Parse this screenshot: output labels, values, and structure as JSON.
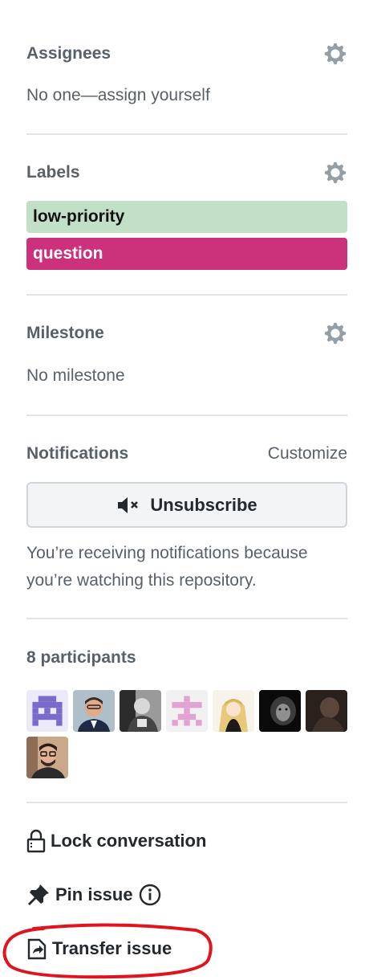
{
  "assignees": {
    "title": "Assignees",
    "value": "No one—assign yourself"
  },
  "labels": {
    "title": "Labels",
    "items": [
      {
        "name": "low-priority",
        "color": "#c2e0c6"
      },
      {
        "name": "question",
        "color": "#cc317c"
      }
    ]
  },
  "milestone": {
    "title": "Milestone",
    "value": "No milestone"
  },
  "notifications": {
    "title": "Notifications",
    "customize": "Customize",
    "button": "Unsubscribe",
    "reason_line1": "You’re receiving notifications because",
    "reason_line2": "you’re watching this repository."
  },
  "participants": {
    "title": "8 participants",
    "avatars": [
      "avatar-1",
      "avatar-2",
      "avatar-3",
      "avatar-4",
      "avatar-5",
      "avatar-6",
      "avatar-7",
      "avatar-8"
    ]
  },
  "actions": {
    "lock": "Lock conversation",
    "pin": "Pin issue",
    "transfer": "Transfer issue"
  },
  "annotation_color": "#e0141e"
}
